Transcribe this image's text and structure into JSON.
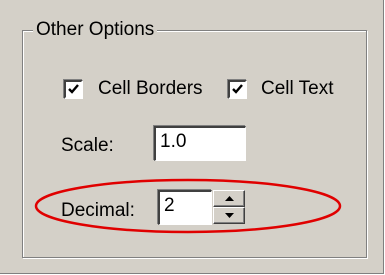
{
  "group": {
    "title": "Other Options"
  },
  "options": {
    "cell_borders": {
      "label": "Cell Borders",
      "checked": true
    },
    "cell_text": {
      "label": "Cell Text",
      "checked": true
    }
  },
  "scale": {
    "label": "Scale:",
    "value": "1.0"
  },
  "decimal": {
    "label": "Decimal:",
    "value": "2"
  },
  "colors": {
    "dialog_bg": "#d4d0c8",
    "highlight_ellipse": "#e00000"
  },
  "icons": {
    "checkmark": "check-icon",
    "spin_up": "triangle-up-icon",
    "spin_down": "triangle-down-icon"
  }
}
